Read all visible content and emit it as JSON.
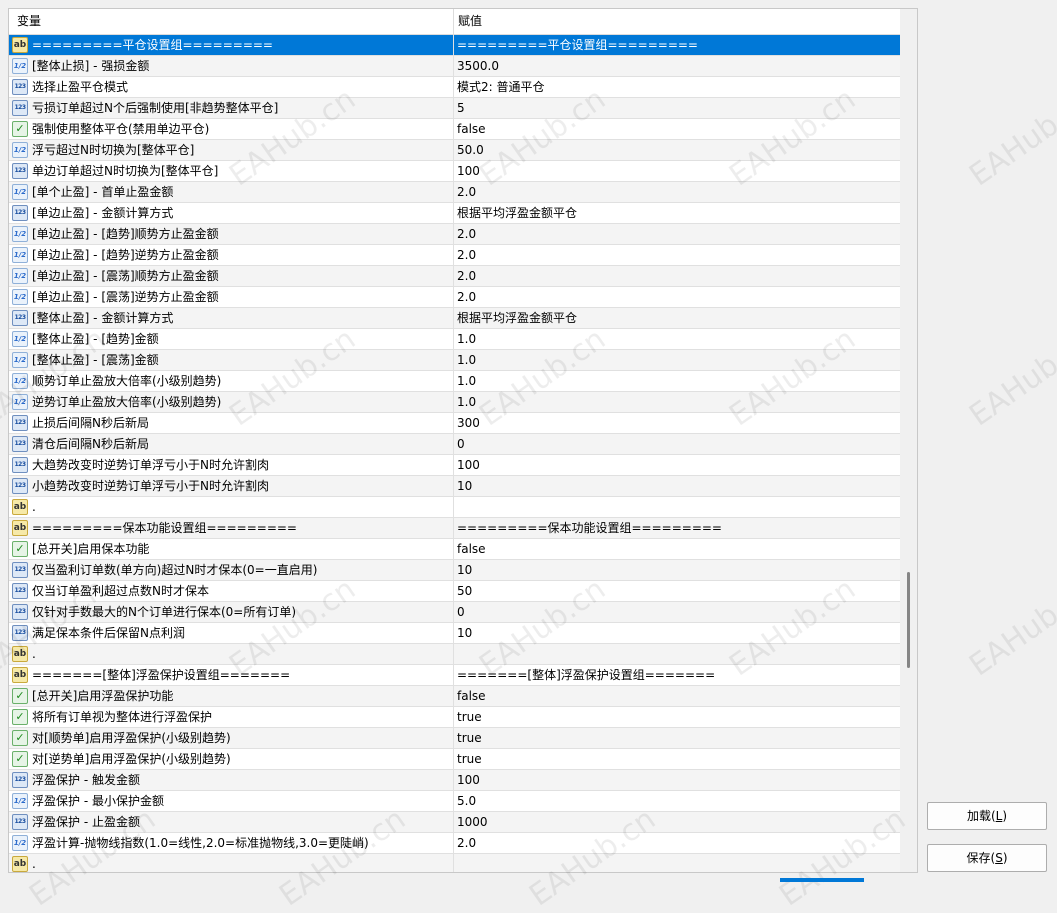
{
  "header": {
    "col_variable": "变量",
    "col_value": "赋值"
  },
  "rows": [
    {
      "icon": "str",
      "name": "=========平仓设置组=========",
      "value": "=========平仓设置组=========",
      "selected": true
    },
    {
      "icon": "dbl",
      "name": "[整体止损] - 强损金额",
      "value": "3500.0"
    },
    {
      "icon": "enm",
      "name": "选择止盈平仓模式",
      "value": "模式2: 普通平仓"
    },
    {
      "icon": "int",
      "name": "亏损订单超过N个后强制使用[非趋势整体平仓]",
      "value": "5"
    },
    {
      "icon": "bool",
      "name": "强制使用整体平仓(禁用单边平仓)",
      "value": "false"
    },
    {
      "icon": "dbl",
      "name": "浮亏超过N时切换为[整体平仓]",
      "value": "50.0"
    },
    {
      "icon": "int",
      "name": "单边订单超过N时切换为[整体平仓]",
      "value": "100"
    },
    {
      "icon": "dbl",
      "name": "[单个止盈] - 首单止盈金额",
      "value": "2.0"
    },
    {
      "icon": "enm",
      "name": "[单边止盈] - 金额计算方式",
      "value": "根据平均浮盈金额平仓"
    },
    {
      "icon": "dbl",
      "name": "[单边止盈] - [趋势]顺势方止盈金额",
      "value": "2.0"
    },
    {
      "icon": "dbl",
      "name": "[单边止盈] - [趋势]逆势方止盈金额",
      "value": "2.0"
    },
    {
      "icon": "dbl",
      "name": "[单边止盈] - [震荡]顺势方止盈金额",
      "value": "2.0"
    },
    {
      "icon": "dbl",
      "name": "[单边止盈] - [震荡]逆势方止盈金额",
      "value": "2.0"
    },
    {
      "icon": "enm",
      "name": "[整体止盈] - 金额计算方式",
      "value": "根据平均浮盈金额平仓"
    },
    {
      "icon": "dbl",
      "name": "[整体止盈] - [趋势]金额",
      "value": "1.0"
    },
    {
      "icon": "dbl",
      "name": "[整体止盈] - [震荡]金额",
      "value": "1.0"
    },
    {
      "icon": "dbl",
      "name": "顺势订单止盈放大倍率(小级别趋势)",
      "value": "1.0"
    },
    {
      "icon": "dbl",
      "name": "逆势订单止盈放大倍率(小级别趋势)",
      "value": "1.0"
    },
    {
      "icon": "int",
      "name": "止损后间隔N秒后新局",
      "value": "300"
    },
    {
      "icon": "int",
      "name": "清仓后间隔N秒后新局",
      "value": "0"
    },
    {
      "icon": "int",
      "name": "大趋势改变时逆势订单浮亏小于N时允许割肉",
      "value": "100"
    },
    {
      "icon": "int",
      "name": "小趋势改变时逆势订单浮亏小于N时允许割肉",
      "value": "10"
    },
    {
      "icon": "str",
      "name": ".",
      "value": ""
    },
    {
      "icon": "str",
      "name": "=========保本功能设置组=========",
      "value": "=========保本功能设置组========="
    },
    {
      "icon": "bool",
      "name": "[总开关]启用保本功能",
      "value": "false"
    },
    {
      "icon": "int",
      "name": "仅当盈利订单数(单方向)超过N时才保本(0=一直启用)",
      "value": "10"
    },
    {
      "icon": "int",
      "name": "仅当订单盈利超过点数N时才保本",
      "value": "50"
    },
    {
      "icon": "int",
      "name": "仅针对手数最大的N个订单进行保本(0=所有订单)",
      "value": "0"
    },
    {
      "icon": "int",
      "name": "满足保本条件后保留N点利润",
      "value": "10"
    },
    {
      "icon": "str",
      "name": ".",
      "value": ""
    },
    {
      "icon": "str",
      "name": "=======[整体]浮盈保护设置组=======",
      "value": "=======[整体]浮盈保护设置组======="
    },
    {
      "icon": "bool",
      "name": "[总开关]启用浮盈保护功能",
      "value": "false"
    },
    {
      "icon": "bool",
      "name": "将所有订单视为整体进行浮盈保护",
      "value": "true"
    },
    {
      "icon": "bool",
      "name": "对[顺势单]启用浮盈保护(小级别趋势)",
      "value": "true"
    },
    {
      "icon": "bool",
      "name": "对[逆势单]启用浮盈保护(小级别趋势)",
      "value": "true"
    },
    {
      "icon": "int",
      "name": "浮盈保护 - 触发金额",
      "value": "100"
    },
    {
      "icon": "dbl",
      "name": "浮盈保护 - 最小保护金额",
      "value": "5.0"
    },
    {
      "icon": "int",
      "name": "浮盈保护 - 止盈金额",
      "value": "1000"
    },
    {
      "icon": "dbl",
      "name": "浮盈计算-抛物线指数(1.0=线性,2.0=标准抛物线,3.0=更陡峭)",
      "value": "2.0"
    },
    {
      "icon": "str",
      "name": ".",
      "value": ""
    }
  ],
  "icons": {
    "str": {
      "glyph": "ab",
      "name": "string-type-icon"
    },
    "int": {
      "glyph": "123",
      "name": "integer-type-icon"
    },
    "enm": {
      "glyph": "123",
      "name": "enum-type-icon"
    },
    "dbl": {
      "glyph": "1/2",
      "name": "double-type-icon"
    },
    "bool": {
      "glyph": "✓",
      "name": "boolean-type-icon"
    }
  },
  "watermark": "EAHub.cn",
  "buttons": {
    "load": {
      "label_main": "加载(",
      "accel": "L",
      "label_end": ")"
    },
    "save": {
      "label_main": "保存(",
      "accel": "S",
      "label_end": ")"
    }
  }
}
